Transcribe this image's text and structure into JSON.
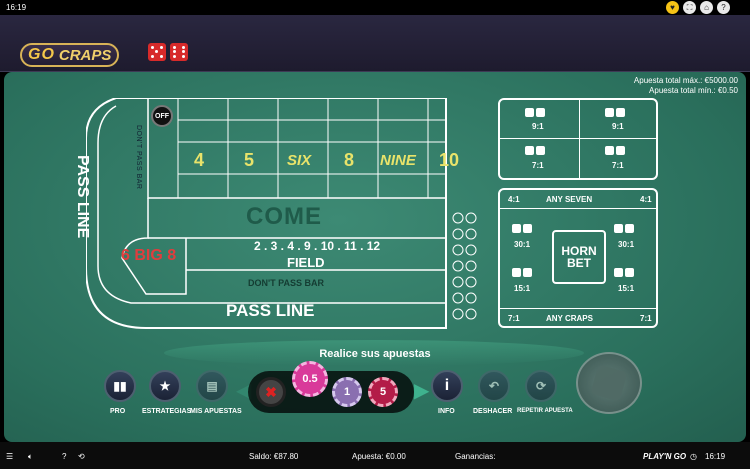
{
  "topbar": {
    "time": "16:19"
  },
  "header": {
    "logo_go": "GO",
    "logo_craps": "CRAPS"
  },
  "limits": {
    "max": "Apuesta total máx.: €5000.00",
    "min": "Apuesta total mín.: €0.50"
  },
  "table": {
    "off_label": "OFF",
    "place_numbers": [
      "4",
      "5",
      "SIX",
      "8",
      "NINE",
      "10"
    ],
    "pass_line_vertical": "PASS LINE",
    "dont_pass_vertical": "DON'T PASS BAR",
    "come": "COME",
    "field_numbers": "2 . 3 . 4 . 9 . 10 . 11 . 12",
    "field": "FIELD",
    "dont_pass_bar": "DON'T PASS BAR",
    "pass_line": "PASS LINE",
    "big68": "6 BIG 8"
  },
  "hardways": {
    "labels": [
      "9:1",
      "9:1",
      "7:1",
      "7:1"
    ]
  },
  "props": {
    "any_seven": "ANY SEVEN",
    "any_seven_odds": "4:1",
    "horn": "HORN BET",
    "odds": [
      "30:1",
      "30:1",
      "15:1",
      "15:1"
    ],
    "any_craps": "ANY CRAPS",
    "any_craps_odds": "7:1"
  },
  "hint": "Realice sus apuestas",
  "controls": {
    "pro": "PRO",
    "estrategias": "ESTRATEGIAS",
    "mis_apuestas": "MIS APUESTAS",
    "info": "INFO",
    "deshacer": "DESHACER",
    "repetir": "REPETIR APUESTA"
  },
  "chips": {
    "values": [
      "0.5",
      "1",
      "5"
    ],
    "selected": "0.5"
  },
  "status": {
    "saldo": "Saldo: €87.80",
    "apuesta": "Apuesta: €0.00",
    "ganancias": "Ganancias:",
    "time": "16:19",
    "brand": "PLAY'N GO"
  },
  "colors": {
    "felt": "#2a6f5c",
    "accent": "#e9e36a",
    "chip_pink": "#d93a9a",
    "chip_purple": "#8a6fb0",
    "chip_red": "#b31c48"
  }
}
